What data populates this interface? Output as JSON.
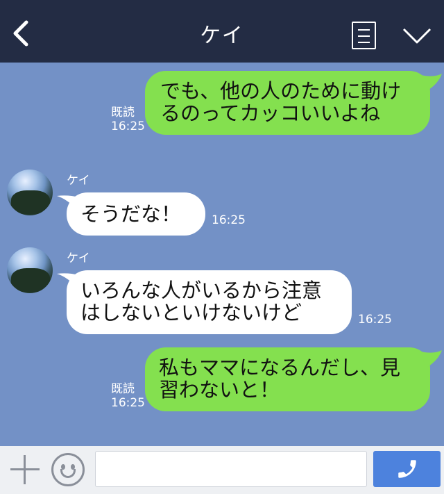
{
  "header": {
    "title": "ケイ"
  },
  "messages": [
    {
      "side": "right",
      "text_lines": [
        "でも、他の人のために動け",
        "るのってカッコいいよね"
      ],
      "read": "既読",
      "time": "16:25"
    },
    {
      "side": "left",
      "name": "ケイ",
      "text_lines": [
        "そうだな！"
      ],
      "time": "16:25"
    },
    {
      "side": "left",
      "name": "ケイ",
      "text_lines": [
        "いろんな人がいるから注意",
        "はしないといけないけど"
      ],
      "time": "16:25"
    },
    {
      "side": "right",
      "text_lines": [
        "私もママになるんだし、見",
        "習わないと！"
      ],
      "read": "既読",
      "time": "16:25"
    }
  ],
  "colors": {
    "header": "#232c44",
    "background": "#7391c6",
    "sent_bubble": "#84e04f",
    "received_bubble": "#ffffff",
    "call_button": "#4d82dd"
  },
  "icons": {
    "back": "chevron-left-icon",
    "menu": "note-icon",
    "collapse": "chevron-down-icon",
    "add": "plus-icon",
    "sticker": "smiley-icon",
    "call": "phone-icon"
  }
}
